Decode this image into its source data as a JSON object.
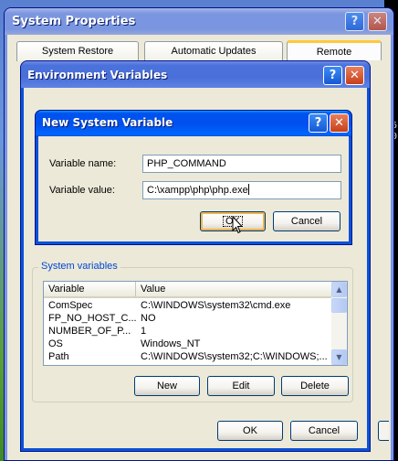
{
  "system_properties": {
    "title": "System Properties",
    "tabs": [
      "System Restore",
      "Automatic Updates",
      "Remote"
    ],
    "help_glyph": "?",
    "close_glyph": "✕"
  },
  "env_vars": {
    "title": "Environment Variables",
    "system_group_label": "System variables",
    "columns": [
      "Variable",
      "Value"
    ],
    "rows": [
      {
        "variable": "ComSpec",
        "value": "C:\\WINDOWS\\system32\\cmd.exe"
      },
      {
        "variable": "FP_NO_HOST_C...",
        "value": "NO"
      },
      {
        "variable": "NUMBER_OF_P...",
        "value": "1"
      },
      {
        "variable": "OS",
        "value": "Windows_NT"
      },
      {
        "variable": "Path",
        "value": "C:\\WINDOWS\\system32;C:\\WINDOWS;..."
      }
    ],
    "buttons": {
      "new": "New",
      "edit": "Edit",
      "delete": "Delete",
      "ok": "OK",
      "cancel": "Cancel"
    },
    "help_glyph": "?",
    "close_glyph": "✕"
  },
  "new_var_dialog": {
    "title": "New System Variable",
    "name_label": "Variable name:",
    "name_value": "PHP_COMMAND",
    "value_label": "Variable value:",
    "value_value": "C:\\xampp\\php\\php.exe",
    "ok": "OK",
    "cancel": "Cancel",
    "help_glyph": "?",
    "close_glyph": "✕"
  },
  "background": {
    "text_fragment": "6\n0"
  },
  "colors": {
    "xp_blue": "#0b52d9",
    "dialog_face": "#ece9d8",
    "group_title": "#0046d5",
    "default_button_ring": "#f0b44c",
    "close_button": "#c6401a"
  },
  "icons": {
    "cursor": "arrow-pointer-icon",
    "scroll_up": "scroll-up-arrow-icon",
    "scroll_down": "scroll-down-arrow-icon"
  }
}
